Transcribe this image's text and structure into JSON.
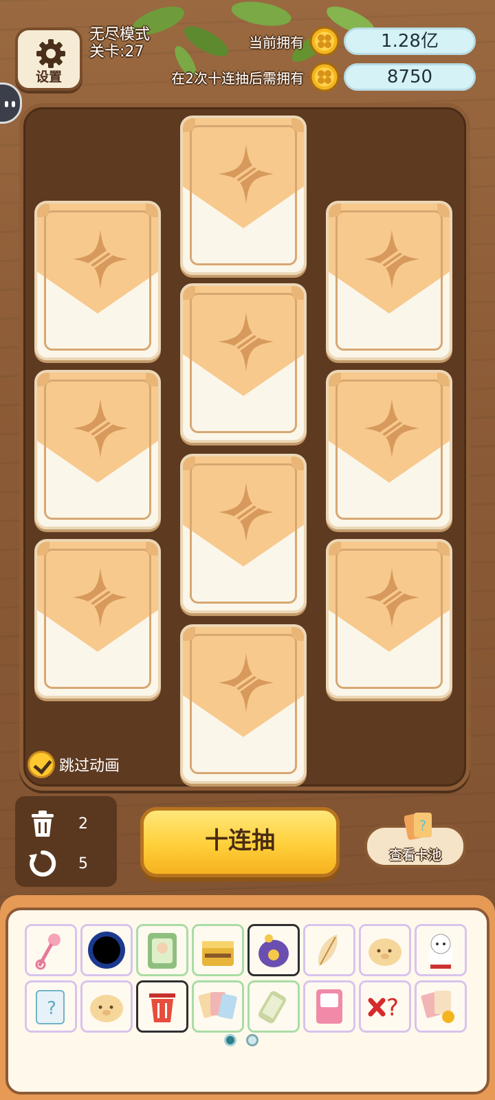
{
  "header": {
    "settings_label": "设置",
    "mode": "无尽模式",
    "level": "关卡:27",
    "current_owned_label": "当前拥有",
    "current_owned_value": "1.28亿",
    "required_label": "在2次十连抽后需拥有",
    "required_value": "8750"
  },
  "board": {
    "skip_animation_label": "跳过动画",
    "skip_checked": true,
    "card_count": 10
  },
  "controls": {
    "trash_count": "2",
    "refresh_count": "5",
    "draw_button_label": "十连抽",
    "view_pool_label": "查看卡池"
  },
  "items": [
    {
      "name": "magic-key-icon"
    },
    {
      "name": "black-hole-icon"
    },
    {
      "name": "elder-card-icon"
    },
    {
      "name": "treasure-box-icon"
    },
    {
      "name": "coin-bag-icon"
    },
    {
      "name": "feather-token-icon"
    },
    {
      "name": "piggy-icon"
    },
    {
      "name": "lucky-cat-icon"
    },
    {
      "name": "mystery-card-icon"
    },
    {
      "name": "piggy-icon"
    },
    {
      "name": "trash-bin-icon"
    },
    {
      "name": "card-pack-icon"
    },
    {
      "name": "scroll-icon"
    },
    {
      "name": "pink-card-icon"
    },
    {
      "name": "remove-question-icon"
    },
    {
      "name": "card-pack-coin-icon"
    }
  ],
  "pager": {
    "pages": 2,
    "current": 1
  },
  "colors": {
    "wood": "#8a5a37",
    "board": "#5e3a21",
    "card_top": "#f7c98d",
    "button_yellow": "#ffcf3a",
    "pill": "#d5f2f7"
  }
}
